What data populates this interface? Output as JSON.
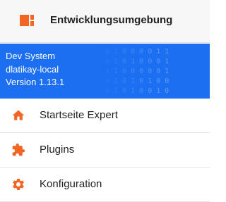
{
  "header": {
    "title": "Entwicklungsumgebung",
    "logo_icon": "app-logo-icon"
  },
  "banner": {
    "background_color": "#1c6ff0",
    "system": "Dev System",
    "host": "dlatikay-local",
    "version": "Version 1.13.1",
    "binary_rows": [
      "0 1 0 0 0 0 1 1",
      "0 1 0 1 0 0 0 1",
      "1 1 0 0 0 0 0 1",
      "0 1 0 1 0 1 0 0",
      "0 1 0 1 0 0 1 0"
    ]
  },
  "menu": {
    "accent_color": "#f26522",
    "items": [
      {
        "label": "Startseite Expert",
        "icon": "home-icon"
      },
      {
        "label": "Plugins",
        "icon": "puzzle-icon"
      },
      {
        "label": "Konfiguration",
        "icon": "gear-icon"
      }
    ]
  }
}
